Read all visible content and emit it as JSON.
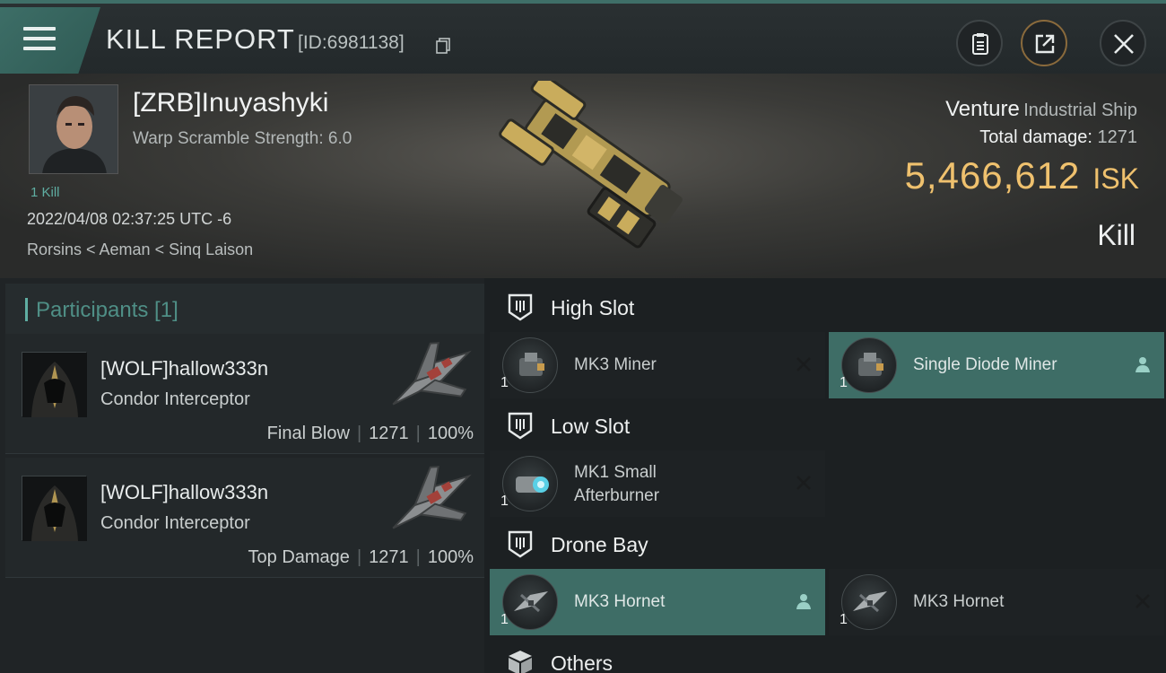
{
  "header": {
    "title": "KILL REPORT",
    "report_id": "[ID:6981138]"
  },
  "victim": {
    "name": "[ZRB]Inuyashyki",
    "warp_scramble": "Warp Scramble Strength: 6.0",
    "kills": "1 Kill",
    "time": "2022/04/08 02:37:25 UTC -6",
    "location": "Rorsins < Aeman < Sinq Laison",
    "ship_name": "Venture",
    "ship_class": "Industrial Ship",
    "damage_label": "Total damage:",
    "damage_value": "1271",
    "isk_value": "5,466,612",
    "isk_unit": "ISK",
    "result": "Kill"
  },
  "participants": {
    "title": "Participants [1]",
    "rows": [
      {
        "name": "[WOLF]hallow333n",
        "ship": "Condor Interceptor",
        "role": "Final Blow",
        "damage": "1271",
        "percent": "100%"
      },
      {
        "name": "[WOLF]hallow333n",
        "ship": "Condor Interceptor",
        "role": "Top Damage",
        "damage": "1271",
        "percent": "100%"
      }
    ]
  },
  "fitting": {
    "high_slot": {
      "title": "High Slot",
      "modules": [
        {
          "name": "MK3 Miner",
          "qty": "1",
          "status": "destroyed"
        },
        {
          "name": "Single Diode Miner",
          "qty": "1",
          "status": "dropped"
        }
      ]
    },
    "low_slot": {
      "title": "Low Slot",
      "modules": [
        {
          "name_line1": "MK1 Small",
          "name_line2": "Afterburner",
          "qty": "1",
          "status": "destroyed"
        }
      ]
    },
    "drone_bay": {
      "title": "Drone Bay",
      "modules": [
        {
          "name": "MK3  Hornet",
          "qty": "1",
          "status": "dropped"
        },
        {
          "name": "MK3  Hornet",
          "qty": "1",
          "status": "destroyed"
        }
      ]
    },
    "others": {
      "title": "Others"
    }
  },
  "colors": {
    "accent_teal": "#3e6d66",
    "isk_gold": "#efc16e",
    "share_button_ring": "#8a6a3c"
  },
  "icons": [
    "menu-icon",
    "copy-icon",
    "clipboard-icon",
    "share-icon",
    "close-icon",
    "slot-icon",
    "cube-icon",
    "destroyed-x-icon",
    "dropped-person-icon"
  ]
}
